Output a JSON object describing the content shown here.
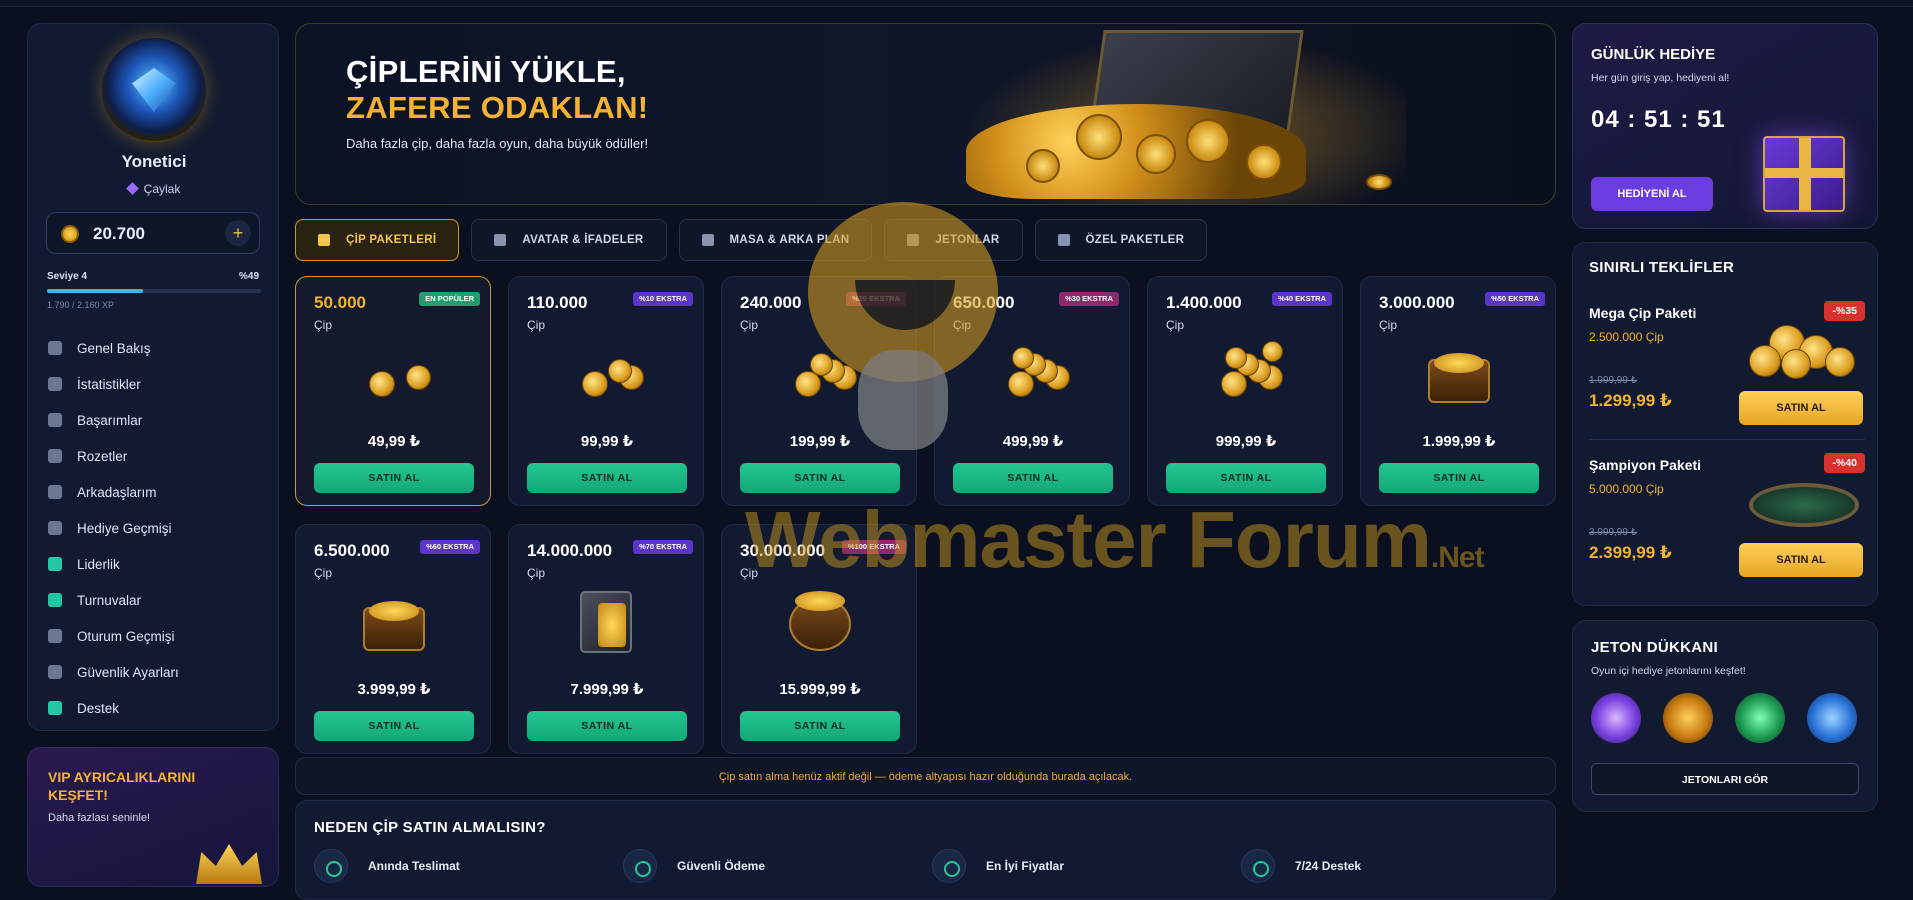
{
  "user": {
    "name": "Yonetici",
    "rank": "Çaylak",
    "balance": "20.700",
    "level_label": "Seviye 4",
    "level_percent_text": "%49",
    "level_progress": 0.49,
    "xp_text": "1.790 / 2.160 XP"
  },
  "sidebar": {
    "items": [
      {
        "label": "Genel Bakış",
        "icon": "dashboard-icon"
      },
      {
        "label": "İstatistikler",
        "icon": "chart-icon"
      },
      {
        "label": "Başarımlar",
        "icon": "trophy-icon"
      },
      {
        "label": "Rozetler",
        "icon": "shield-icon"
      },
      {
        "label": "Arkadaşlarım",
        "icon": "users-icon"
      },
      {
        "label": "Hediye Geçmişi",
        "icon": "gift-icon"
      },
      {
        "label": "Liderlik",
        "icon": "cup-icon"
      },
      {
        "label": "Turnuvalar",
        "icon": "cup-icon"
      },
      {
        "label": "Oturum Geçmişi",
        "icon": "history-icon"
      },
      {
        "label": "Güvenlik Ayarları",
        "icon": "lock-icon"
      },
      {
        "label": "Destek",
        "icon": "headset-icon"
      }
    ],
    "vip_title": "VIP AYRICALIKLARINI KEŞFET!",
    "vip_subtitle": "Daha fazlası seninle!"
  },
  "hero": {
    "line1": "ÇİPLERİNİ YÜKLE,",
    "line2": "ZAFERE ODAKLAN!",
    "subtitle": "Daha fazla çip, daha fazla oyun, daha büyük ödüller!"
  },
  "tabs": [
    {
      "label": "ÇİP PAKETLERİ",
      "active": true
    },
    {
      "label": "AVATAR & İFADELER",
      "active": false
    },
    {
      "label": "MASA & ARKA PLAN",
      "active": false
    },
    {
      "label": "JETONLAR",
      "active": false
    },
    {
      "label": "ÖZEL PAKETLER",
      "active": false
    }
  ],
  "packages": [
    {
      "amount": "50.000",
      "unit": "Çip",
      "badge": "EN POPÜLER",
      "price": "49,99 ₺",
      "buy": "SATIN AL"
    },
    {
      "amount": "110.000",
      "unit": "Çip",
      "badge": "%10 EKSTRA",
      "price": "99,99 ₺",
      "buy": "SATIN AL"
    },
    {
      "amount": "240.000",
      "unit": "Çip",
      "badge": "%20 EKSTRA",
      "price": "199,99 ₺",
      "buy": "SATIN AL"
    },
    {
      "amount": "650.000",
      "unit": "Çip",
      "badge": "%30 EKSTRA",
      "price": "499,99 ₺",
      "buy": "SATIN AL"
    },
    {
      "amount": "1.400.000",
      "unit": "Çip",
      "badge": "%40 EKSTRA",
      "price": "999,99 ₺",
      "buy": "SATIN AL"
    },
    {
      "amount": "3.000.000",
      "unit": "Çip",
      "badge": "%50 EKSTRA",
      "price": "1.999,99 ₺",
      "buy": "SATIN AL"
    },
    {
      "amount": "6.500.000",
      "unit": "Çip",
      "badge": "%60 EKSTRA",
      "price": "3.999,99 ₺",
      "buy": "SATIN AL"
    },
    {
      "amount": "14.000.000",
      "unit": "Çip",
      "badge": "%70 EKSTRA",
      "price": "7.999,99 ₺",
      "buy": "SATIN AL"
    },
    {
      "amount": "30.000.000",
      "unit": "Çip",
      "badge": "%100 EKSTRA",
      "price": "15.999,99 ₺",
      "buy": "SATIN AL"
    }
  ],
  "notice": "Çip satın alma henüz aktif değil — ödeme altyapısı hazır olduğunda burada açılacak.",
  "why": {
    "title": "NEDEN ÇİP SATIN ALMALISIN?",
    "features": [
      "Anında Teslimat",
      "Güvenli Ödeme",
      "En İyi Fiyatlar",
      "7/24 Destek"
    ]
  },
  "daily_gift": {
    "title": "GÜNLÜK HEDİYE",
    "subtitle": "Her gün giriş yap, hediyeni al!",
    "timer": "04 : 51 : 51",
    "button": "HEDİYENİ AL"
  },
  "offers": {
    "title": "SINIRLI TEKLİFLER",
    "items": [
      {
        "name": "Mega Çip Paketi",
        "chips": "2.500.000 Çip",
        "old_price": "1.999,99 ₺",
        "new_price": "1.299,99 ₺",
        "discount": "-%35",
        "button": "SATIN AL"
      },
      {
        "name": "Şampiyon Paketi",
        "chips": "5.000.000 Çip",
        "old_price": "3.999,99 ₺",
        "new_price": "2.399,99 ₺",
        "discount": "-%40",
        "button": "SATIN AL"
      }
    ]
  },
  "token_shop": {
    "title": "JETON DÜKKANI",
    "subtitle": "Oyun içi hediye jetonlarını keşfet!",
    "tokens": [
      "diamond-token-icon",
      "coin-token-icon",
      "clover-token-icon",
      "star-token-icon"
    ],
    "button": "JETONLARI GÖR"
  },
  "watermark": {
    "text": "Webmaster Forum",
    "suffix": ".Net"
  },
  "colors": {
    "accent_gold": "#f3b233",
    "buy_green": "#1fbf8a",
    "badge_purple": "#5b34c9",
    "discount_red": "#d8322f",
    "gift_purple": "#6b3ce0"
  }
}
